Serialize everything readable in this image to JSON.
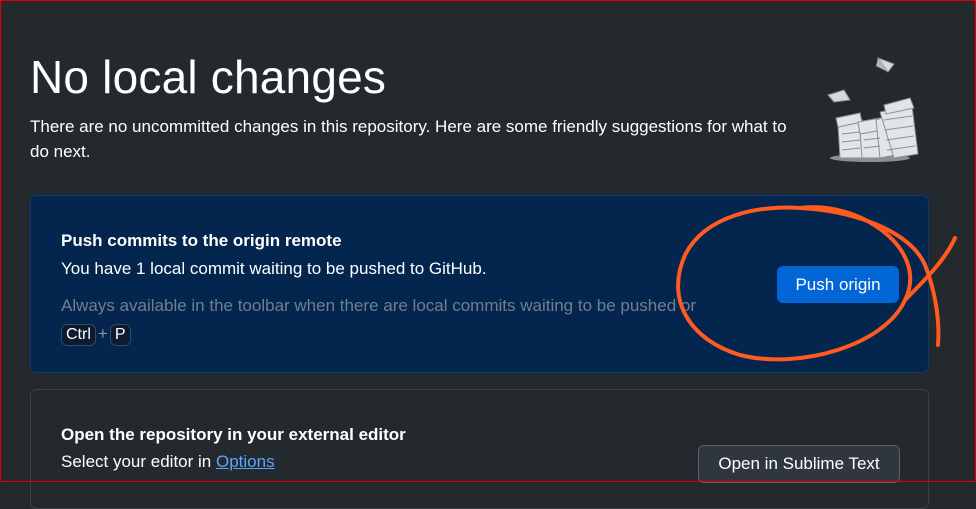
{
  "header": {
    "title": "No local changes",
    "subtitle": "There are no uncommitted changes in this repository. Here are some friendly suggestions for what to do next."
  },
  "illustration": {
    "icon": "paper-stacks-illustration-icon"
  },
  "push_card": {
    "title": "Push commits to the origin remote",
    "description": "You have 1 local commit waiting to be pushed to GitHub.",
    "hint": "Always available in the toolbar when there are local commits waiting to be pushed or",
    "shortcut_key1": "Ctrl",
    "shortcut_plus": "+",
    "shortcut_key2": "P",
    "button_label": "Push origin"
  },
  "editor_card": {
    "title": "Open the repository in your external editor",
    "description": "Select your editor in",
    "link": "Options",
    "button_label": "Open in Sublime Text"
  },
  "colors": {
    "background": "#24292e",
    "push_card_bg": "#04254d",
    "primary_button": "#0366d6",
    "annotation": "#ff5a1f",
    "frame": "#e00000"
  }
}
